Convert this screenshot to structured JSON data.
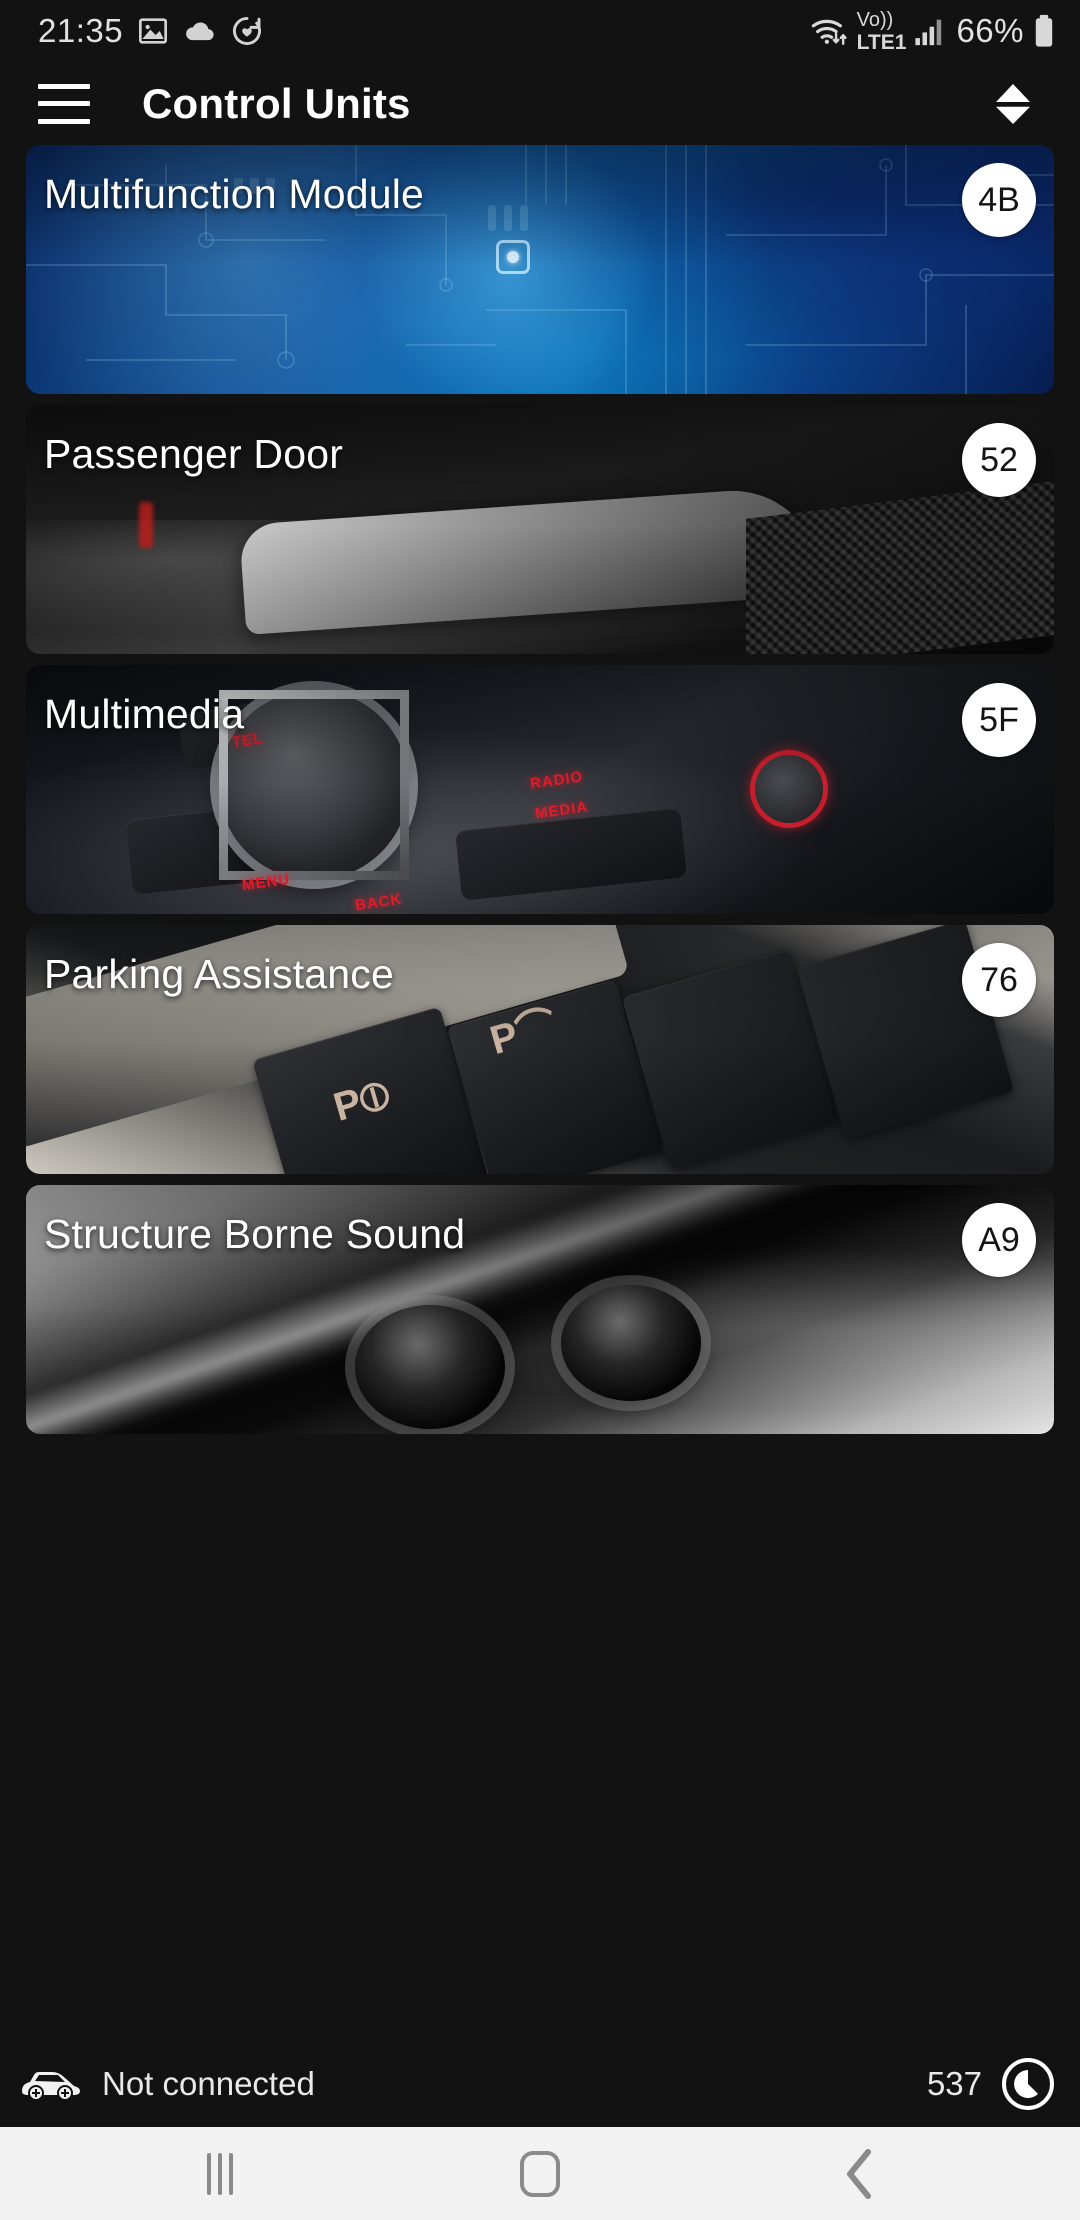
{
  "status_bar": {
    "time": "21:35",
    "left_icons": [
      "gallery-icon",
      "cloud-icon",
      "health-heart-icon"
    ],
    "wifi_icon": "wifi-data-icon",
    "volte_label_top": "Vo))",
    "volte_label_bottom": "LTE1",
    "signal_icon": "signal-bars-icon",
    "battery_percent": "66%",
    "battery_icon": "battery-icon"
  },
  "app_bar": {
    "menu_icon": "hamburger-menu-icon",
    "title": "Control Units",
    "sort_icon": "sort-ascending-descending-icon"
  },
  "control_units": [
    {
      "name": "Multifunction Module",
      "address": "4B",
      "image": "blue-circuit-board"
    },
    {
      "name": "Passenger Door",
      "address": "52",
      "image": "car-door-handle"
    },
    {
      "name": "Multimedia",
      "address": "5F",
      "image": "mmi-control-knob"
    },
    {
      "name": "Parking Assistance",
      "address": "76",
      "image": "parking-buttons"
    },
    {
      "name": "Structure Borne Sound",
      "address": "A9",
      "image": "exhaust-pipes"
    }
  ],
  "footer": {
    "car_icon": "car-icon",
    "connection_status": "Not connected",
    "count": "537",
    "brand_icon": "carly-logo-icon"
  },
  "nav_bar": {
    "recents_label": "recents-icon",
    "home_label": "home-icon",
    "back_label": "back-icon"
  },
  "colors": {
    "background": "#121212",
    "badge_bg": "#ffffff",
    "badge_text": "#141414",
    "title_text": "#ffffff",
    "navbar_bg": "#f2f2f2"
  }
}
